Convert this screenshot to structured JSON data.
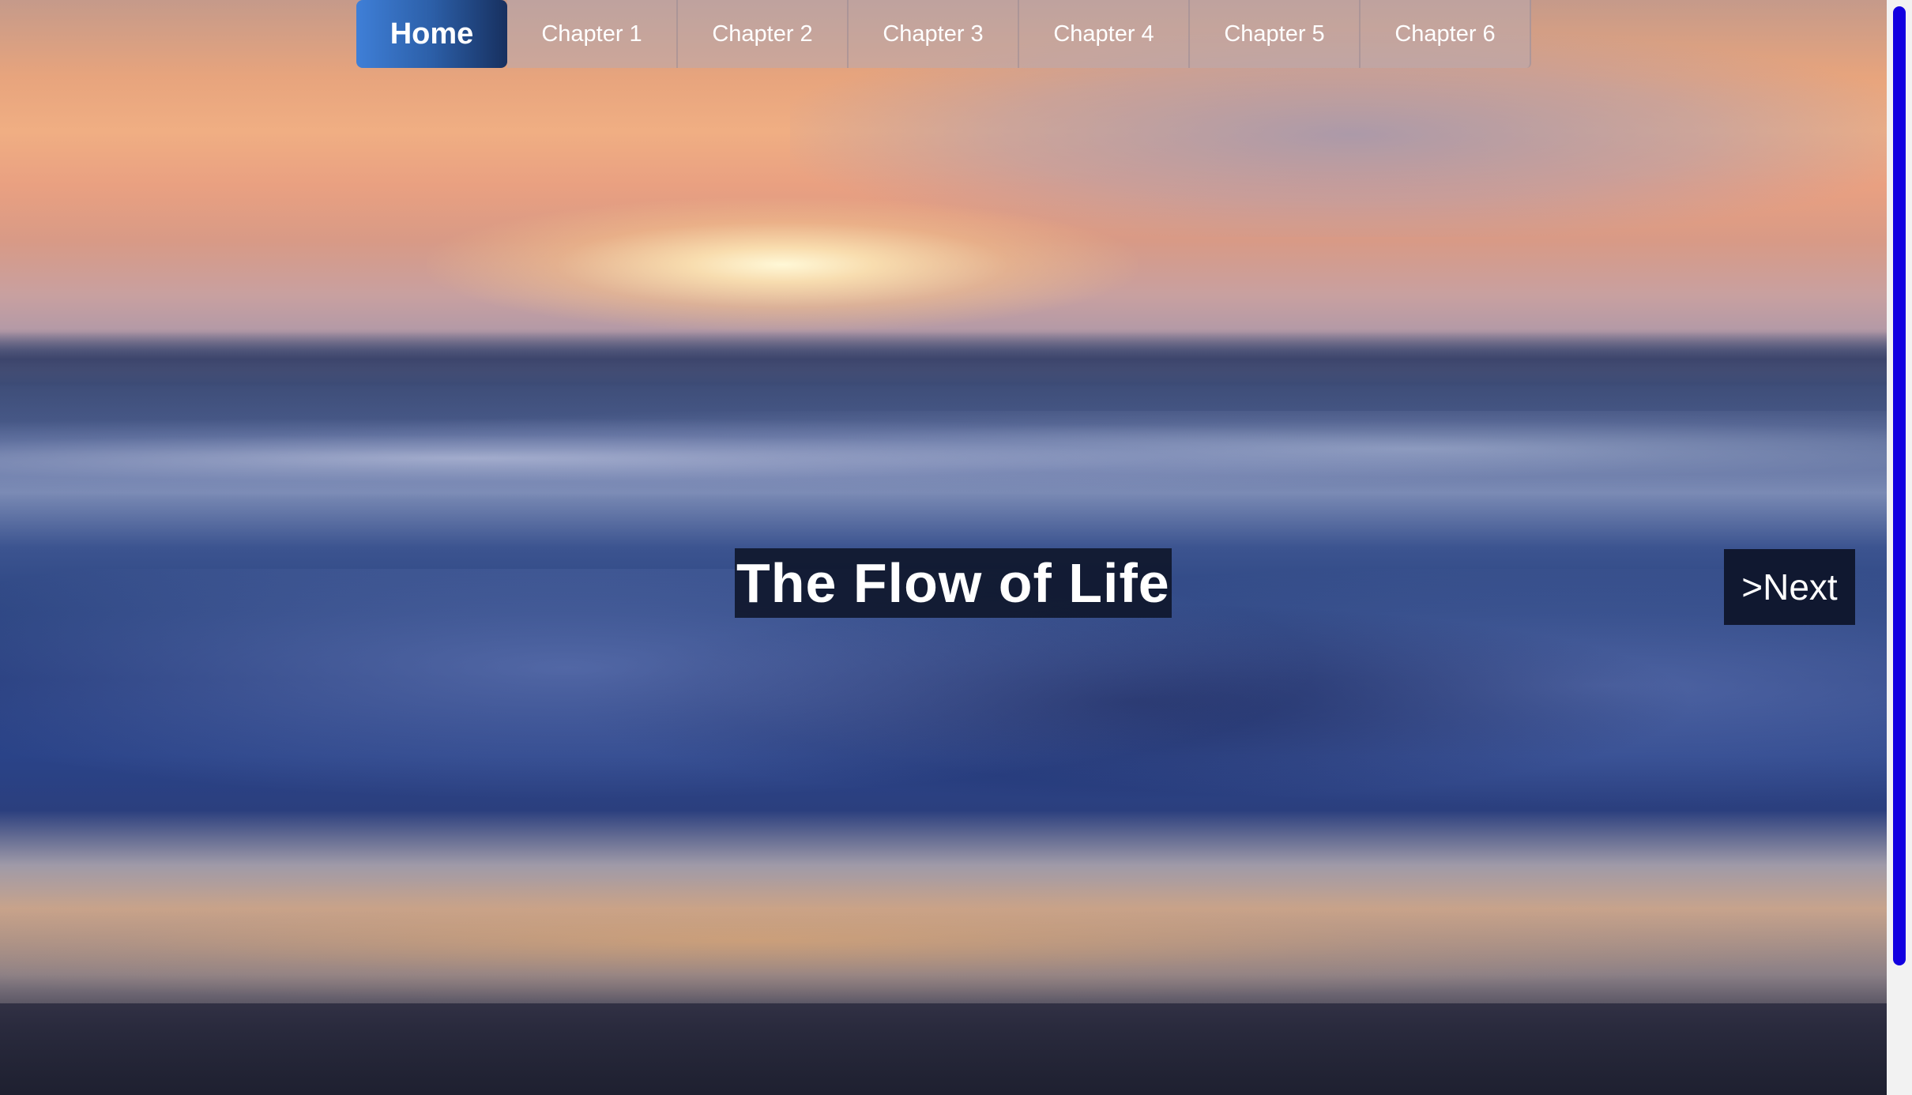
{
  "nav": {
    "items": [
      {
        "label": "Home",
        "active": true
      },
      {
        "label": "Chapter 1",
        "active": false
      },
      {
        "label": "Chapter 2",
        "active": false
      },
      {
        "label": "Chapter 3",
        "active": false
      },
      {
        "label": "Chapter 4",
        "active": false
      },
      {
        "label": "Chapter 5",
        "active": false
      },
      {
        "label": "Chapter 6",
        "active": false
      }
    ]
  },
  "hero": {
    "title": "The Flow of Life",
    "next_label": ">Next"
  },
  "colors": {
    "home_accent": "#3f7fd7",
    "scroll_thumb": "#1200e0",
    "title_background": "#0e1428"
  }
}
